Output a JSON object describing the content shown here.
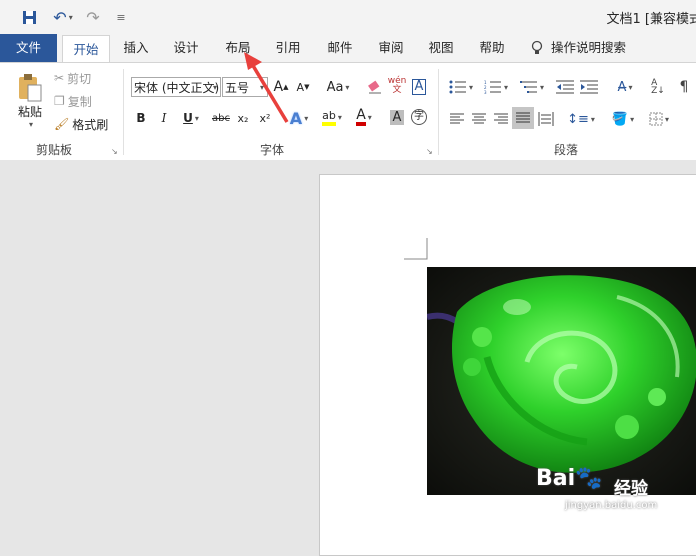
{
  "quick_access": {
    "undo_label": "↶",
    "redo_label": "↷",
    "customize_label": "≡"
  },
  "window": {
    "title": "文档1 [兼容模式"
  },
  "tabs": [
    {
      "label": "文件"
    },
    {
      "label": "开始"
    },
    {
      "label": "插入"
    },
    {
      "label": "设计"
    },
    {
      "label": "布局"
    },
    {
      "label": "引用"
    },
    {
      "label": "邮件"
    },
    {
      "label": "审阅"
    },
    {
      "label": "视图"
    },
    {
      "label": "帮助"
    }
  ],
  "tell_me": {
    "label": "操作说明搜索"
  },
  "clipboard": {
    "paste": "粘贴",
    "cut": "剪切",
    "copy": "复制",
    "format_painter": "格式刷",
    "group_label": "剪贴板"
  },
  "font": {
    "family": "宋体 (中文正文)",
    "size": "五号",
    "grow": "A",
    "shrink": "A",
    "case": "Aa",
    "bold": "B",
    "italic": "I",
    "underline": "U",
    "strike": "abc",
    "subscript": "x₂",
    "superscript": "x²",
    "group_label": "字体"
  },
  "paragraph": {
    "group_label": "段落"
  },
  "annotation": {
    "arrow_color": "#e8403c"
  },
  "watermark": {
    "brand": "Bai",
    "paw": "🐾",
    "brand_suffix": "经验",
    "site": "jingyan.baidu.com"
  },
  "colors": {
    "accent": "#2b579a",
    "highlight": "#ffff00",
    "font_color": "#d00000"
  }
}
